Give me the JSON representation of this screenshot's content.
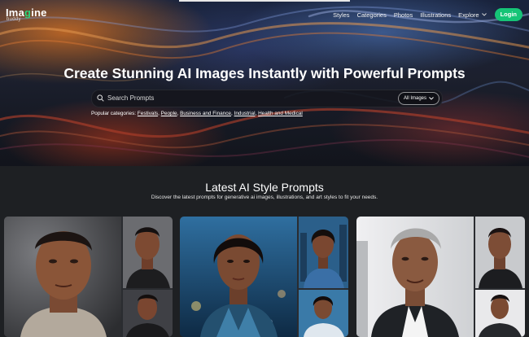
{
  "nav": {
    "logo_text_a": "Ima",
    "logo_text_accent": "g",
    "logo_text_b": "ine",
    "logo_sub": "buddy",
    "links": [
      "Styles",
      "Categories",
      "Photos",
      "Illustrations"
    ],
    "explore_label": "Explore",
    "login_label": "Login"
  },
  "hero": {
    "title": "Create Stunning AI Images Instantly with Powerful Prompts",
    "search_placeholder": "Search Prompts",
    "filter_selected": "All Images",
    "popular_label": "Popular categories:",
    "popular_categories": [
      "Festivals",
      "People",
      "Business and Finance",
      "Industrial",
      "Health and Medical"
    ]
  },
  "latest": {
    "title": "Latest AI Style Prompts",
    "subtitle": "Discover the latest prompts for generative ai images, illustrations, and art styles to fit your needs."
  },
  "colors": {
    "accent": "#16c477",
    "page_bg": "#1e2023"
  },
  "icons": [
    "search-icon",
    "chevron-down-icon"
  ]
}
